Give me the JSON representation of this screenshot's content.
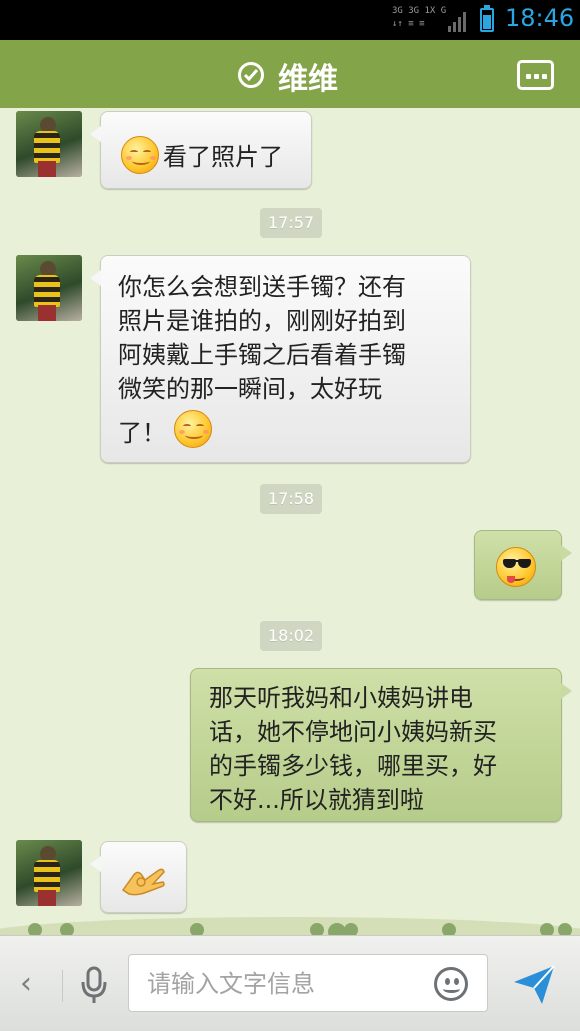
{
  "status_bar": {
    "network_top": "3G 3G 1X G",
    "network_bottom": "↓↑ ≡ ≡",
    "time": "18:46",
    "battery_level": 0.7,
    "accent_color": "#2aa6e0"
  },
  "header": {
    "title": "维维",
    "verified_icon": "check-circle-icon",
    "menu_icon": "more-icon",
    "background_color": "#84a44a"
  },
  "messages": [
    {
      "direction": "in",
      "text": "看了照片了",
      "emoji_before": "smile-emoji"
    },
    {
      "type": "timestamp",
      "text": "17:57"
    },
    {
      "direction": "in",
      "lines": [
        "你怎么会想到送手镯？还有",
        "照片是谁拍的，刚刚好拍到",
        "阿姨戴上手镯之后看着手镯",
        "微笑的那一瞬间，太好玩",
        "了！"
      ],
      "emoji_after": "smile-emoji"
    },
    {
      "type": "timestamp",
      "text": "17:58"
    },
    {
      "direction": "out",
      "emoji": "cool-sunglasses-emoji"
    },
    {
      "type": "timestamp",
      "text": "18:02"
    },
    {
      "direction": "out",
      "lines": [
        "那天听我妈和小姨妈讲电",
        "话，她不停地问小姨妈新买",
        "的手镯多少钱，哪里买，好",
        "不好...所以就猜到啦"
      ]
    },
    {
      "direction": "in",
      "emoji": "ok-hand-emoji"
    }
  ],
  "input_bar": {
    "back_icon": "chevron-left-icon",
    "voice_icon": "microphone-icon",
    "placeholder": "请输入文字信息",
    "emoji_icon": "smiley-icon",
    "send_icon": "send-icon",
    "send_color": "#2a8fd8"
  }
}
